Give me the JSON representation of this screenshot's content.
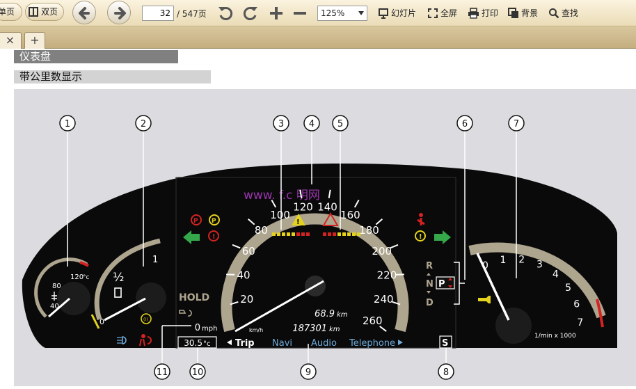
{
  "toolbar": {
    "single_page": "单页",
    "double_page": "双页",
    "current_page": "32",
    "total_pages": "/ 547页",
    "zoom": "125%",
    "slideshow": "幻灯片",
    "fullscreen": "全屏",
    "print": "打印",
    "background": "背景",
    "find": "查找"
  },
  "tabs": {
    "close": "×",
    "add": "+"
  },
  "document": {
    "heading1": "仪表盘",
    "heading2": "带公里数显示"
  },
  "cluster": {
    "callouts": [
      "1",
      "2",
      "3",
      "4",
      "5",
      "6",
      "7",
      "8",
      "9",
      "10",
      "11"
    ],
    "watermark": "www.   f.c  明网",
    "speed_ticks": [
      "20",
      "40",
      "60",
      "80",
      "100",
      "120",
      "140",
      "160",
      "180",
      "200",
      "220",
      "240",
      "260"
    ],
    "speed_unit": "km/h",
    "trip_km": "68.9",
    "total_km": "187301",
    "km_unit": "km",
    "hold": "HOLD",
    "mph_value": "0",
    "mph_unit": "mph",
    "outside_temp": "30.5",
    "temp_unit": "°c",
    "menu_trip": "Trip",
    "menu_navi": "Navi",
    "menu_audio": "Audio",
    "menu_telephone": "Telephone",
    "gear_r": "R",
    "gear_n": "N",
    "gear_d": "D",
    "gear_p": "P",
    "s_mode": "S",
    "rpm_ticks": [
      "0",
      "1",
      "2",
      "3",
      "4",
      "5",
      "6",
      "7"
    ],
    "rpm_unit": "1/min x 1000",
    "coolant_max": "120",
    "coolant_unit": "°c",
    "coolant_mid": "80",
    "coolant_min": "40",
    "fuel_half": "½",
    "fuel_full": "1",
    "fuel_empty": "0",
    "colors": {
      "dashboard": "#0a0a0a",
      "scale": "#aea58f",
      "warning_red": "#d52222",
      "indicator_green": "#34a84a",
      "amber": "#e4d21b",
      "menu_blue": "#6ea9d6"
    }
  }
}
